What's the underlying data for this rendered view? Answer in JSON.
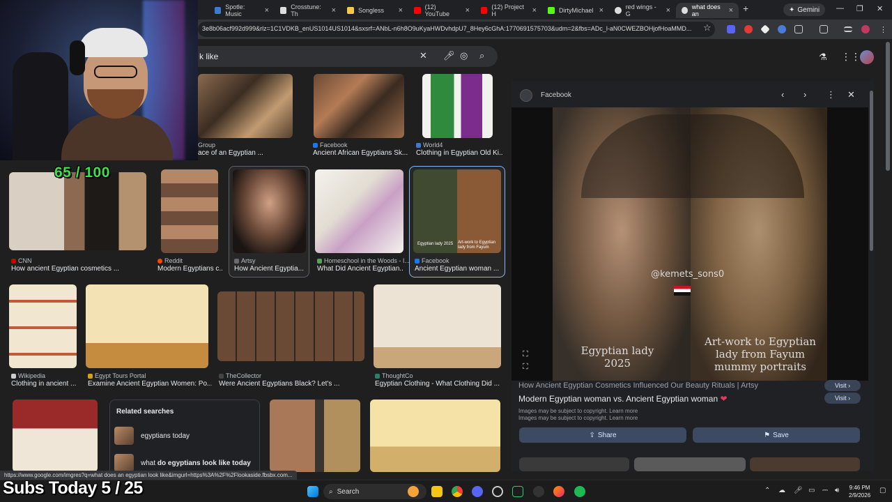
{
  "browser": {
    "tabs": [
      {
        "label": "Spotle: Music",
        "color": "#1db954"
      },
      {
        "label": "Crosstune: Th",
        "color": "#cccccc"
      },
      {
        "label": "Songless",
        "color": "#f7c948"
      },
      {
        "label": "(12) YouTube",
        "color": "#ff0000"
      },
      {
        "label": "(12) Project H",
        "color": "#ff0000"
      },
      {
        "label": "DirtyMichael",
        "color": "#53fc18"
      },
      {
        "label": "red wings - G",
        "color": "#dddddd"
      },
      {
        "label": "what does an",
        "color": "#dddddd"
      }
    ],
    "gemini_label": "Gemini",
    "url": "3e8b06acf992d999&rlz=1C1VDKB_enUS1014US1014&sxsrf=ANbL-n6h8O9uKyaHWDvhdpU7_8Hey6cGhA:1770691575703&udm=2&fbs=ADc_l-aN0CWEZBOHjofHoaMMD..."
  },
  "search": {
    "query_fragment": "k like"
  },
  "results": {
    "row1": [
      {
        "source": "Group",
        "caption": "ace of an Egyptian ...",
        "icon_color": "#888888"
      },
      {
        "source": "Facebook",
        "caption": "Ancient African Egyptians Sk...",
        "icon_color": "#1877f2"
      },
      {
        "source": "World4",
        "caption": "Clothing in Egyptian Old Ki...",
        "icon_color": "#3b7bd4"
      }
    ],
    "row2": [
      {
        "source": "CNN",
        "caption": "How ancient Egyptian cosmetics ...",
        "icon_color": "#cc0000"
      },
      {
        "source": "Reddit",
        "caption": "Modern Egyptians c...",
        "icon_color": "#ff4500"
      },
      {
        "source": "Artsy",
        "caption": "How Ancient Egyptia...",
        "icon_color": "#6b6b6b"
      },
      {
        "source": "Homeschool in the Woods - I...",
        "caption": "What Did Ancient Egyptian...",
        "icon_color": "#5aa05a"
      },
      {
        "source": "Facebook",
        "caption": "Ancient Egyptian woman ...",
        "icon_color": "#1877f2"
      }
    ],
    "row3": [
      {
        "source": "Wikipedia",
        "caption": "Clothing in ancient ...",
        "icon_color": "#cccccc"
      },
      {
        "source": "Egypt Tours Portal",
        "caption": "Examine Ancient Egyptian Women: Po...",
        "icon_color": "#d4a017"
      },
      {
        "source": "TheCollector",
        "caption": "Were Ancient Egyptians Black? Let's ...",
        "icon_color": "#444444"
      },
      {
        "source": "ThoughtCo",
        "caption": "Egyptian Clothing - What Clothing Did ...",
        "icon_color": "#2e7d6b"
      }
    ],
    "thumb_text": {
      "egyptian_lady": "Egyptian lady 2025",
      "artwork": "Art-work to Egyptian lady from Fayum"
    }
  },
  "related": {
    "title": "Related searches",
    "items": [
      {
        "pre": "",
        "bold": "",
        "text": "egyptians today"
      },
      {
        "pre": "what ",
        "bold": "do egyptians",
        "text": " look like today"
      }
    ]
  },
  "panel": {
    "source_label": "Facebook",
    "watermark": "@kemets_sons0",
    "caption_left": "Egyptian lady 2025",
    "caption_right": "Art-work to Egyptian lady from Fayum mummy portraits",
    "title_prev": "How Ancient Egyptian Cosmetics Influenced Our Beauty Rituals | Artsy",
    "title": "Modern Egyptian woman vs. Ancient Egyptian woman",
    "heart": "❤",
    "visit_label": "Visit",
    "copyright_prev": "Images may be subject to copyright. Learn more",
    "copyright": "Images may be subject to copyright. Learn more",
    "share_label": "Share",
    "save_label": "Save"
  },
  "status_url": "https://www.google.com/imgres?q=what does an egyptian look like&imgurl=https%3A%2F%2Flookaside.fbsbx.com...",
  "taskbar": {
    "search_label": "Search",
    "time": "9:46 PM",
    "date": "2/9/2026"
  },
  "overlay": {
    "score": "65 / 100",
    "subs": "Subs Today  5 / 25"
  }
}
